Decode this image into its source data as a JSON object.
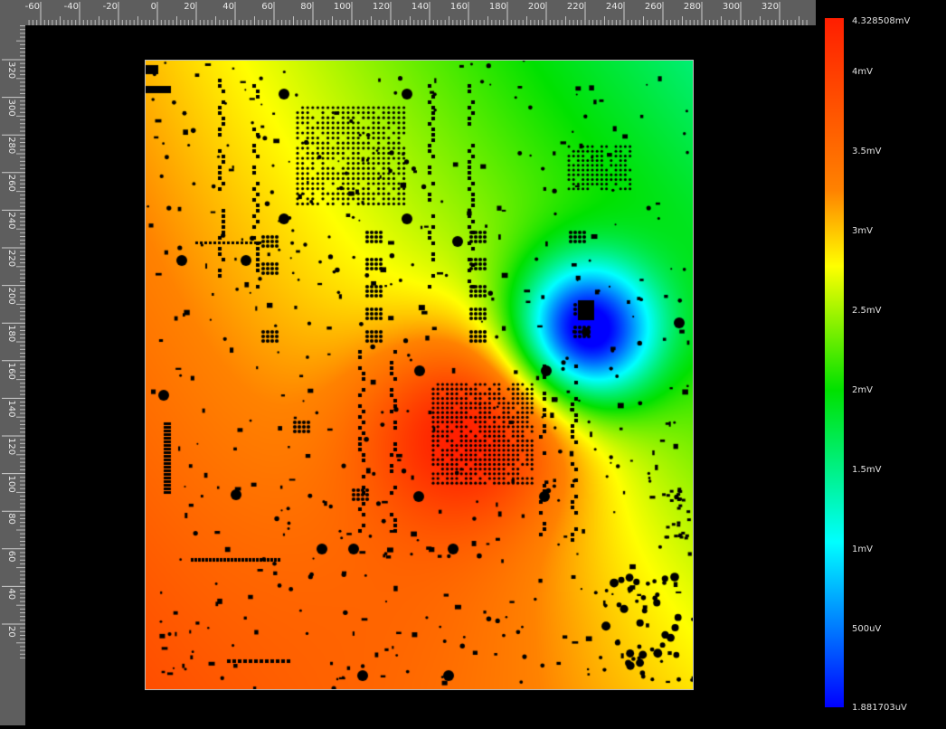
{
  "ruler": {
    "horizontal_ticks": [
      "-60",
      "-40",
      "-20",
      "0",
      "20",
      "40",
      "60",
      "80",
      "100",
      "120",
      "140",
      "160",
      "180",
      "200",
      "220",
      "240",
      "260",
      "280",
      "300",
      "320"
    ],
    "vertical_ticks": [
      "320",
      "300",
      "280",
      "260",
      "240",
      "220",
      "200",
      "180",
      "160",
      "140",
      "120",
      "100",
      "80",
      "60",
      "40",
      "20"
    ]
  },
  "chart_data": {
    "type": "heatmap",
    "title": "",
    "xlabel": "",
    "ylabel": "",
    "colorbar": {
      "max_label": "4.328508mV",
      "min_label": "1.881703uV",
      "ticks": [
        "4mV",
        "3.5mV",
        "3mV",
        "2.5mV",
        "2mV",
        "1.5mV",
        "1mV",
        "500uV"
      ],
      "colors": [
        "#ff1e00",
        "#ff8200",
        "#ffff00",
        "#00e100",
        "#00ffff",
        "#0000ff"
      ]
    },
    "peak_region": "center-left (red)",
    "minimum_region": "right-middle (blue)"
  }
}
